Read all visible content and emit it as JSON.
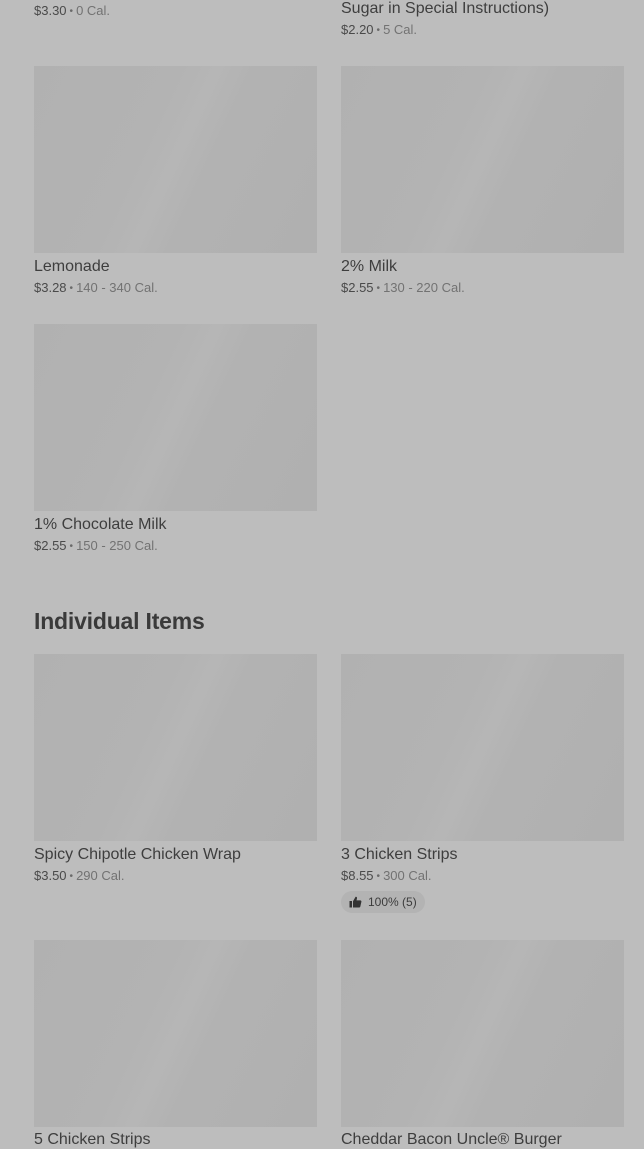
{
  "top_row": {
    "left": {
      "price": "$3.30",
      "calories": "0 Cal."
    },
    "right": {
      "name_tail": "Sugar in Special Instructions)",
      "price": "$2.20",
      "calories": "5 Cal."
    }
  },
  "beverages": [
    {
      "name": "Lemonade",
      "price": "$3.28",
      "calories": "140 - 340 Cal."
    },
    {
      "name": "2% Milk",
      "price": "$2.55",
      "calories": "130 - 220 Cal."
    },
    {
      "name": "1% Chocolate Milk",
      "price": "$2.55",
      "calories": "150 - 250 Cal."
    }
  ],
  "individual_section": {
    "title": "Individual Items",
    "items": [
      {
        "name": "Spicy Chipotle Chicken Wrap",
        "price": "$3.50",
        "calories": "290 Cal."
      },
      {
        "name": "3 Chicken Strips",
        "price": "$8.55",
        "calories": "300 Cal.",
        "rating": "100% (5)"
      },
      {
        "name": "5 Chicken Strips"
      },
      {
        "name": "Cheddar Bacon Uncle® Burger"
      }
    ]
  },
  "separator": "•",
  "colors": {
    "background": "#bdbdbd",
    "placeholder": "#b2b2b2",
    "text": "#3a3a3a"
  }
}
